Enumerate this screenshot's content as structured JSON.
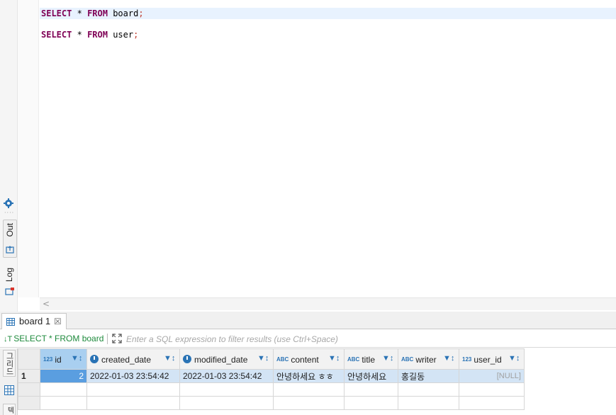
{
  "editor": {
    "lines": [
      {
        "keyword1": "SELECT",
        "star": "*",
        "keyword2": "FROM",
        "table": "board",
        "end": ";"
      },
      {
        "keyword1": "SELECT",
        "star": "*",
        "keyword2": "FROM",
        "table": "user",
        "end": ";"
      }
    ],
    "scroll_left_glyph": "<"
  },
  "side_panel": {
    "out_label": "Out",
    "log_label": "Log"
  },
  "results_tab": {
    "label": "board 1",
    "close_glyph": "☒"
  },
  "filter_bar": {
    "source_icon": "↓T",
    "source_text": "SELECT * FROM board",
    "placeholder": "Enter a SQL expression to filter results (use Ctrl+Space)"
  },
  "grid_side": {
    "grid_tab_label": "그리드",
    "text_tab_label": "텍스트"
  },
  "grid": {
    "columns": [
      {
        "type_badge": "123",
        "icon": "numeric-icon",
        "label": "id"
      },
      {
        "type_badge": "",
        "icon": "clock-icon",
        "label": "created_date"
      },
      {
        "type_badge": "",
        "icon": "clock-icon",
        "label": "modified_date"
      },
      {
        "type_badge": "ABC",
        "icon": "text-icon",
        "label": "content"
      },
      {
        "type_badge": "ABC",
        "icon": "text-icon",
        "label": "title"
      },
      {
        "type_badge": "ABC",
        "icon": "text-icon",
        "label": "writer"
      },
      {
        "type_badge": "123",
        "icon": "fk-numeric-icon",
        "label": "user_id"
      }
    ],
    "sort_glyph": "▼↕",
    "rows": [
      {
        "row_number": "1",
        "id": "2",
        "created_date": "2022-01-03 23:54:42",
        "modified_date": "2022-01-03 23:54:42",
        "content": "안녕하세요 ㅎㅎ",
        "title": "안녕하세요",
        "writer": "홍길동",
        "user_id": "[NULL]"
      }
    ]
  },
  "colors": {
    "keyword": "#7f0055",
    "selection": "#5a9ee0",
    "row_highlight": "#d3e4f5",
    "accent_blue": "#2a73b5",
    "source_green": "#1e8a3c"
  }
}
